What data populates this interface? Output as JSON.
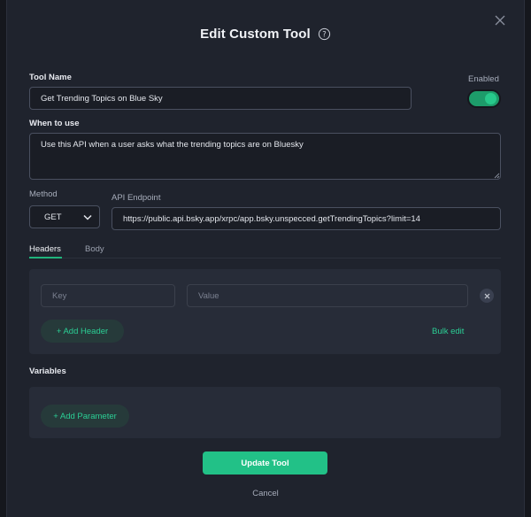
{
  "modal": {
    "title": "Edit Custom Tool"
  },
  "tool_name": {
    "label": "Tool Name",
    "value": "Get Trending Topics on Blue Sky"
  },
  "enabled": {
    "label": "Enabled",
    "state": true
  },
  "when_to_use": {
    "label": "When to use",
    "value": "Use this API when a user asks what the trending topics are on Bluesky"
  },
  "method": {
    "label": "Method",
    "value": "GET"
  },
  "api_endpoint": {
    "label": "API Endpoint",
    "value": "https://public.api.bsky.app/xrpc/app.bsky.unspecced.getTrendingTopics?limit=14"
  },
  "tabs": [
    {
      "label": "Headers",
      "active": true
    },
    {
      "label": "Body",
      "active": false
    }
  ],
  "headers": {
    "key_placeholder": "Key",
    "value_placeholder": "Value",
    "add_label": "+ Add Header",
    "bulk_edit_label": "Bulk edit"
  },
  "variables": {
    "label": "Variables",
    "add_label": "+ Add Parameter"
  },
  "actions": {
    "submit_label": "Update Tool",
    "cancel_label": "Cancel"
  },
  "colors": {
    "accent": "#22c187",
    "background": "#1f232d"
  }
}
